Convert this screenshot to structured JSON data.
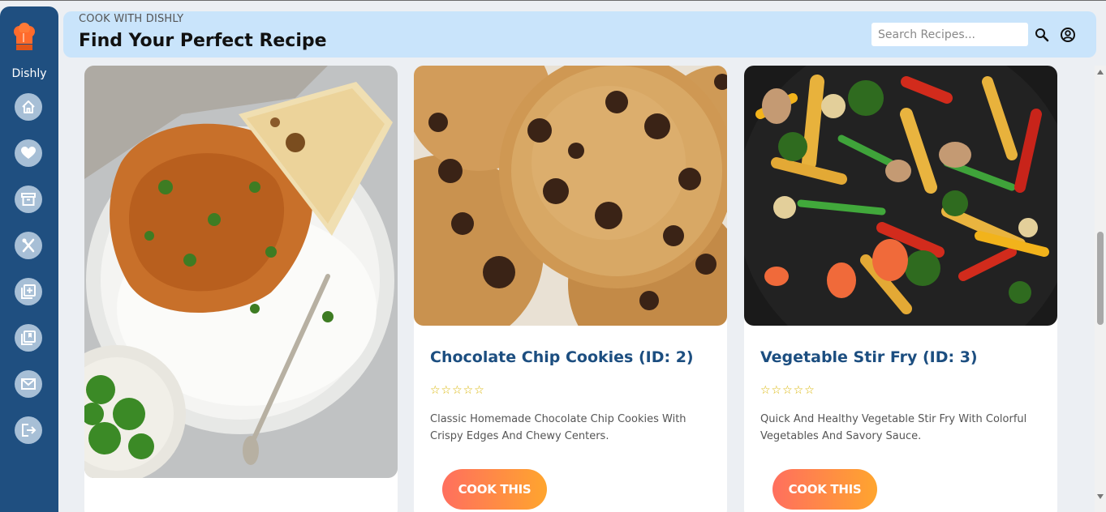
{
  "app": {
    "brand": "Dishly"
  },
  "nav": [
    {
      "icon": "home-icon"
    },
    {
      "icon": "heart-icon"
    },
    {
      "icon": "archive-icon"
    },
    {
      "icon": "utensils-icon"
    },
    {
      "icon": "add-recipe-icon"
    },
    {
      "icon": "library-icon"
    },
    {
      "icon": "mail-icon"
    },
    {
      "icon": "logout-icon"
    }
  ],
  "header": {
    "subtitle": "COOK WITH DISHLY",
    "title": "Find Your Perfect Recipe",
    "search_placeholder": "Search Recipes..."
  },
  "recipes": [
    {
      "title": "",
      "rating": "",
      "description": "",
      "button": ""
    },
    {
      "title": "Chocolate Chip Cookies (ID: 2)",
      "rating": "☆☆☆☆☆",
      "description": "Classic Homemade Chocolate Chip Cookies With Crispy Edges And Chewy Centers.",
      "button": "COOK THIS"
    },
    {
      "title": "Vegetable Stir Fry (ID: 3)",
      "rating": "☆☆☆☆☆",
      "description": "Quick And Healthy Vegetable Stir Fry With Colorful Vegetables And Savory Sauce.",
      "button": "COOK THIS"
    }
  ],
  "colors": {
    "sidebar": "#1f4f80",
    "header": "#c9e4fb",
    "accent_title": "#1c4e80",
    "button_gradient_start": "#ff6f5e",
    "button_gradient_end": "#ffa52e",
    "stars": "#d9b400"
  }
}
